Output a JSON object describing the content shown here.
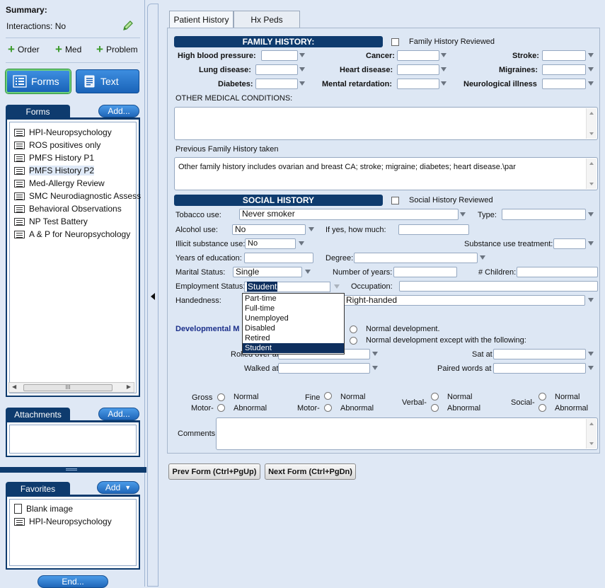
{
  "summary": {
    "title": "Summary:",
    "interactions": "Interactions: No",
    "actions": [
      "Order",
      "Med",
      "Problem"
    ]
  },
  "mode_buttons": {
    "forms": "Forms",
    "text": "Text"
  },
  "forms_panel": {
    "title": "Forms",
    "add": "Add...",
    "items": [
      "HPI-Neuropsychology",
      "ROS positives only",
      "PMFS History P1",
      "PMFS History P2",
      "Med-Allergy Review",
      "SMC Neurodiagnostic Assess",
      "Behavioral Observations",
      "NP Test Battery",
      "A & P for Neuropsychology"
    ],
    "scroll_thumb": "III"
  },
  "attachments_panel": {
    "title": "Attachments",
    "add": "Add..."
  },
  "favorites_panel": {
    "title": "Favorites",
    "add": "Add",
    "items": [
      "Blank image",
      "HPI-Neuropsychology"
    ]
  },
  "end_button": "End...",
  "tabs": [
    "Patient History",
    "Hx Peds"
  ],
  "family": {
    "banner": "FAMILY HISTORY:",
    "reviewed": "Family History Reviewed",
    "labels": {
      "hbp": "High blood pressure:",
      "cancer": "Cancer:",
      "stroke": "Stroke:",
      "lung": "Lung disease:",
      "heart": "Heart disease:",
      "migraines": "Migraines:",
      "diabetes": "Diabetes:",
      "mental": "Mental retardation:",
      "neuro": "Neurological illness"
    },
    "other_label": "OTHER MEDICAL CONDITIONS:",
    "previous_label": "Previous Family History taken",
    "previous_text": "Other family history includes ovarian and breast CA; stroke; migraine; diabetes; heart disease.\\par"
  },
  "social": {
    "banner": "SOCIAL HISTORY",
    "reviewed": "Social History Reviewed",
    "tobacco_label": "Tobacco use:",
    "tobacco_value": "Never smoker",
    "type_label": "Type:",
    "alcohol_label": "Alcohol use:",
    "alcohol_value": "No",
    "howmuch_label": "If yes, how much:",
    "illicit_label": "Illicit substance use:",
    "illicit_value": "No",
    "treatment_label": "Substance use treatment:",
    "education_label": "Years of education:",
    "degree_label": "Degree:",
    "marital_label": "Marital Status:",
    "marital_value": "Single",
    "years_label": "Number of years:",
    "children_label": "# Children:",
    "employment_label": "Employment Status:",
    "employment_value": "Student",
    "occupation_label": "Occupation:",
    "handedness_label": "Handedness:",
    "handedness_value": "Right-handed",
    "employment_options": [
      "Part-time",
      "Full-time",
      "Unemployed",
      "Disabled",
      "Retired",
      "Student"
    ]
  },
  "developmental": {
    "label": "Developmental M",
    "normal": "Normal development.",
    "except": "Normal development except with the following:",
    "rolled": "Rolled over at",
    "sat": "Sat at",
    "walked": "Walked at",
    "paired": "Paired words at",
    "gross": "Gross",
    "motor": "Motor-",
    "fine": "Fine",
    "verbal": "Verbal-",
    "social": "Social-",
    "normal_opt": "Normal",
    "abnormal_opt": "Abnormal",
    "comments": "Comments:"
  },
  "nav": {
    "prev": "Prev Form (Ctrl+PgUp)",
    "next": "Next Form (Ctrl+PgDn)"
  }
}
